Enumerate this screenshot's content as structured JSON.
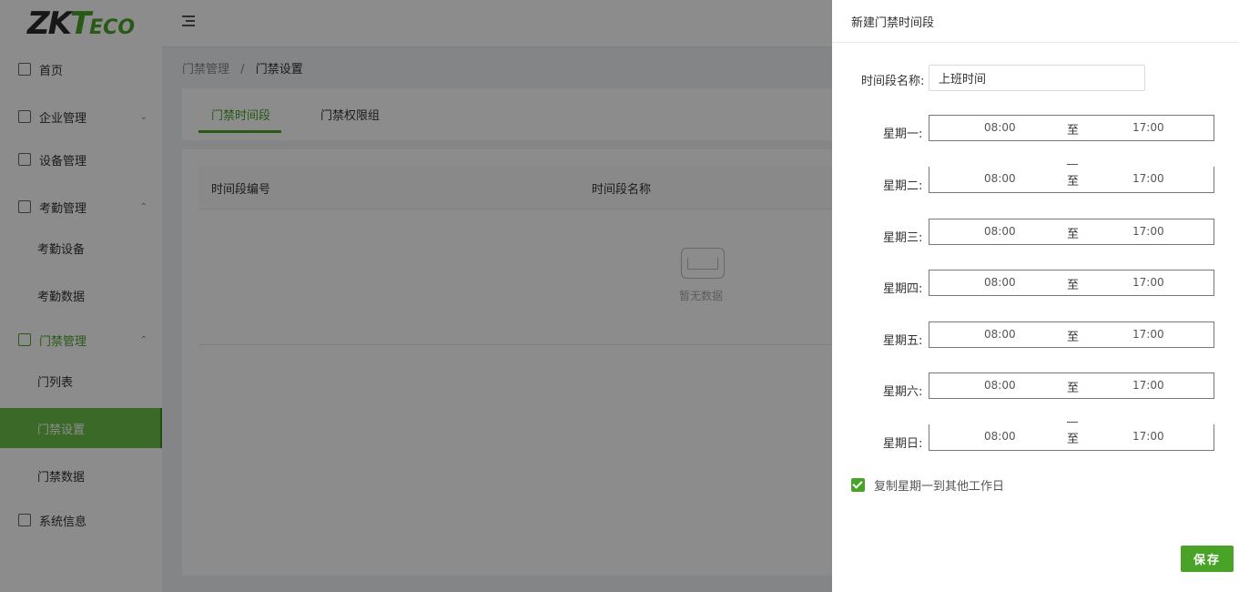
{
  "logo": {
    "brand_zk": "ZK",
    "brand_t": "T",
    "brand_eco": "ECO"
  },
  "sidebar": {
    "items": [
      {
        "label": "首页",
        "icon": "home-icon"
      },
      {
        "label": "企业管理",
        "icon": "building-icon",
        "arrow": "⌄"
      },
      {
        "label": "设备管理",
        "icon": "device-icon"
      },
      {
        "label": "考勤管理",
        "icon": "calendar-icon",
        "arrow": "⌃"
      },
      {
        "label": "考勤设备"
      },
      {
        "label": "考勤数据"
      },
      {
        "label": "门禁管理",
        "icon": "door-icon",
        "arrow": "⌃"
      },
      {
        "label": "门列表"
      },
      {
        "label": "门禁设置"
      },
      {
        "label": "门禁数据"
      },
      {
        "label": "系统信息",
        "icon": "info-screen-icon"
      }
    ]
  },
  "breadcrumb": {
    "parent": "门禁管理",
    "separator": "/",
    "current": "门禁设置"
  },
  "tabs": [
    {
      "label": "门禁时间段"
    },
    {
      "label": "门禁权限组"
    }
  ],
  "table": {
    "columns": [
      "时间段编号",
      "时间段名称"
    ],
    "empty_text": "暂无数据"
  },
  "drawer": {
    "title": "新建门禁时间段",
    "name_label": "时间段名称:",
    "name_value": "上班时间",
    "days": [
      {
        "label": "星期一:",
        "start": "08:00",
        "sep": "至",
        "end": "17:00"
      },
      {
        "label": "星期二:",
        "start": "08:00",
        "sep": "至",
        "end": "17:00"
      },
      {
        "label": "星期三:",
        "start": "08:00",
        "sep": "至",
        "end": "17:00"
      },
      {
        "label": "星期四:",
        "start": "08:00",
        "sep": "至",
        "end": "17:00"
      },
      {
        "label": "星期五:",
        "start": "08:00",
        "sep": "至",
        "end": "17:00"
      },
      {
        "label": "星期六:",
        "start": "08:00",
        "sep": "至",
        "end": "17:00"
      },
      {
        "label": "星期日:",
        "start": "08:00",
        "sep": "至",
        "end": "17:00"
      }
    ],
    "copy_label": "复制星期一到其他工作日",
    "copy_checked": true,
    "save_label": "保存"
  },
  "colors": {
    "accent": "#4aa329",
    "active_nav": "#6cc04a",
    "mask": "rgba(0,0,0,0.45)"
  }
}
